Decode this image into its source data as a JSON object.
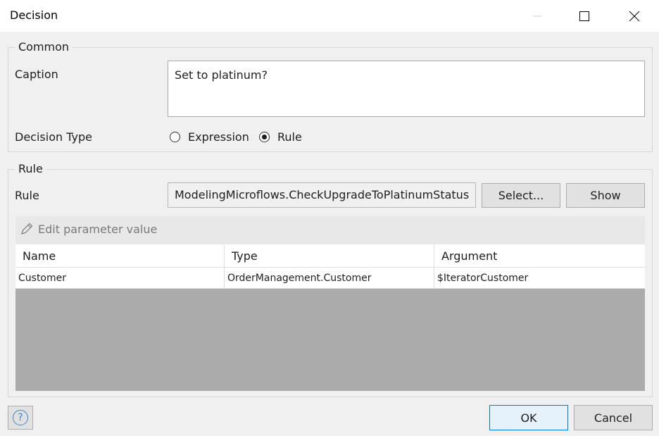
{
  "window": {
    "title": "Decision",
    "controls": [
      "minimize-icon",
      "maximize-icon",
      "close-icon"
    ]
  },
  "common": {
    "group_label": "Common",
    "caption_label": "Caption",
    "caption_value": "Set to platinum?",
    "decision_type_label": "Decision Type",
    "decision_type_options": [
      {
        "label": "Expression",
        "selected": false
      },
      {
        "label": "Rule",
        "selected": true
      }
    ]
  },
  "rule": {
    "group_label": "Rule",
    "rule_label": "Rule",
    "rule_value": "ModelingMicroflows.CheckUpgradeToPlatinumStatus",
    "select_button": "Select...",
    "show_button": "Show",
    "edit_parameter_label": "Edit parameter value",
    "edit_parameter_icon": "pencil-icon",
    "table": {
      "columns": [
        "Name",
        "Type",
        "Argument"
      ],
      "rows": [
        [
          "Customer",
          "OrderManagement.Customer",
          "$IteratorCustomer"
        ]
      ]
    }
  },
  "footer": {
    "help_icon": "question-icon",
    "help_glyph": "?",
    "ok_button": "OK",
    "cancel_button": "Cancel"
  },
  "colors": {
    "accent": "#0078d7",
    "help": "#3d84c7",
    "grid_empty": "#ababab"
  }
}
